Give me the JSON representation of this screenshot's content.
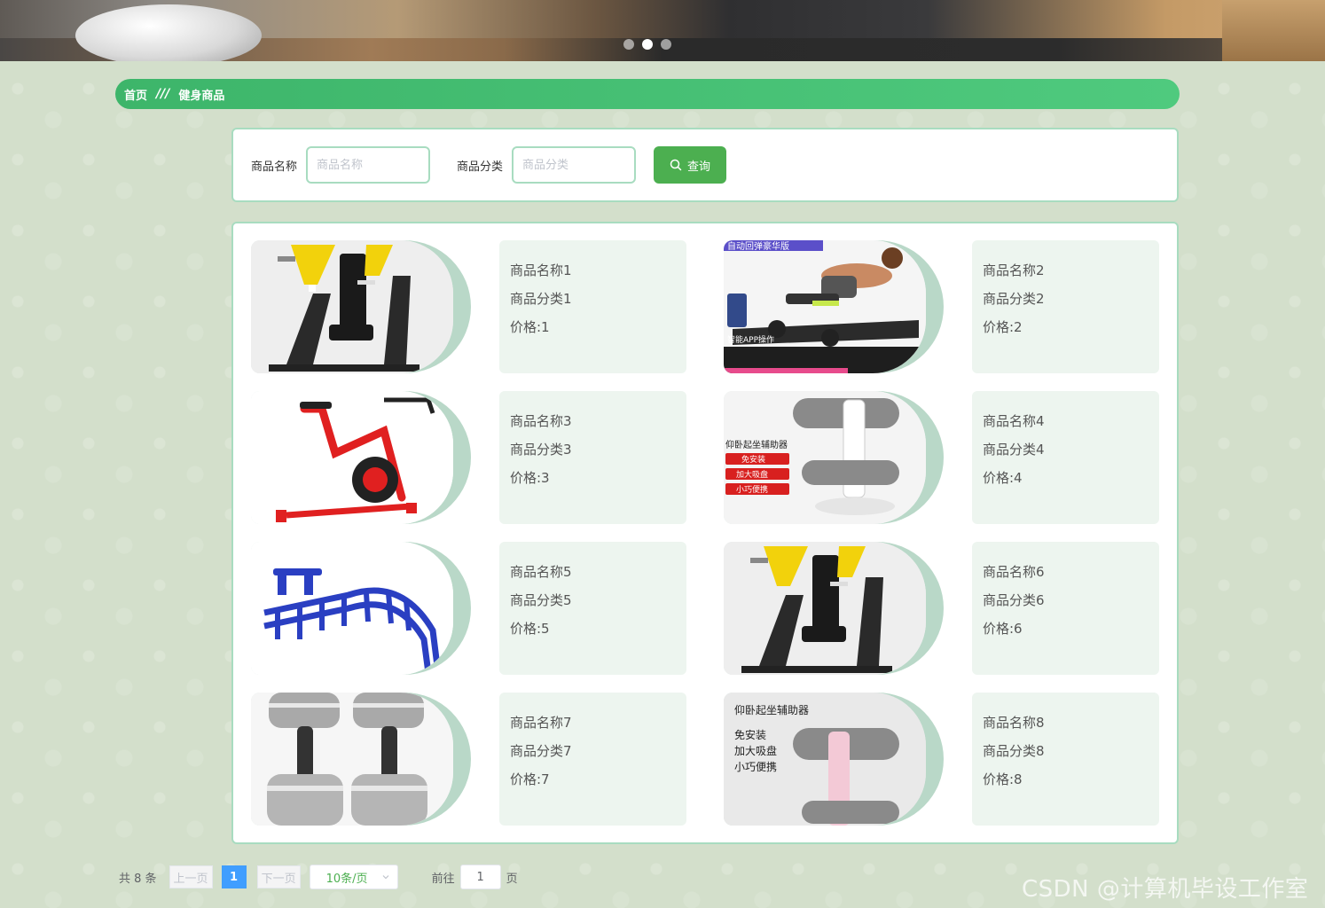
{
  "banner": {
    "slides": 3,
    "active_slide": 2
  },
  "breadcrumb": {
    "home": "首页",
    "separator": "///",
    "current": "健身商品"
  },
  "search": {
    "name_label": "商品名称",
    "name_placeholder": "商品名称",
    "category_label": "商品分类",
    "category_placeholder": "商品分类",
    "button_label": "查询"
  },
  "products": [
    {
      "name": "商品名称1",
      "category": "商品分类1",
      "price": "价格:1",
      "image": "chest-press-machine"
    },
    {
      "name": "商品名称2",
      "category": "商品分类2",
      "price": "价格:2",
      "image": "rowing-bench"
    },
    {
      "name": "商品名称3",
      "category": "商品分类3",
      "price": "价格:3",
      "image": "spin-bike"
    },
    {
      "name": "商品名称4",
      "category": "商品分类4",
      "price": "价格:4",
      "image": "situp-assistant",
      "caption": [
        "仰卧起坐辅助器",
        "免安装",
        "加大吸盘",
        "小巧便携"
      ]
    },
    {
      "name": "商品名称5",
      "category": "商品分类5",
      "price": "价格:5",
      "image": "outdoor-situp-bench"
    },
    {
      "name": "商品名称6",
      "category": "商品分类6",
      "price": "价格:6",
      "image": "chest-press-machine"
    },
    {
      "name": "商品名称7",
      "category": "商品分类7",
      "price": "价格:7",
      "image": "dumbbells"
    },
    {
      "name": "商品名称8",
      "category": "商品分类8",
      "price": "价格:8",
      "image": "situp-assistant-pink",
      "caption": [
        "仰卧起坐辅助器",
        "免安装",
        "加大吸盘",
        "小巧便携"
      ]
    }
  ],
  "product2_caption": [
    "自动回弹豪华版",
    "智能APP操作"
  ],
  "pagination": {
    "total": "共 8 条",
    "prev": "上一页",
    "current_page": "1",
    "next": "下一页",
    "page_size": "10条/页",
    "goto_label": "前往",
    "goto_value": "1",
    "page_unit": "页"
  },
  "watermark": "CSDN @计算机毕设工作室"
}
